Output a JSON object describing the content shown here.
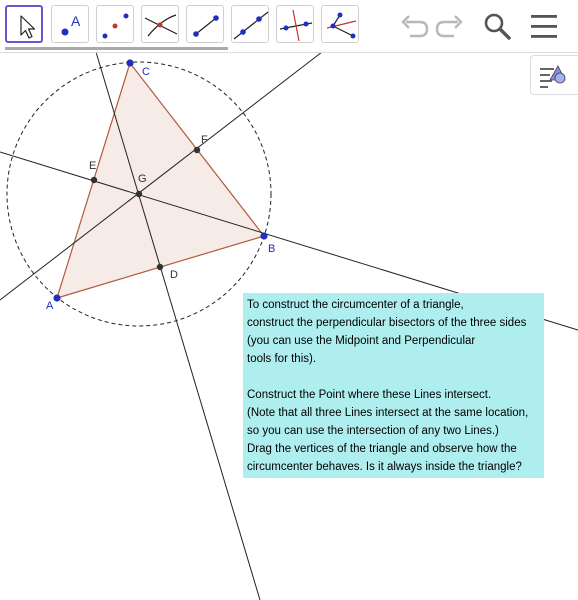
{
  "toolbar": {
    "tools": [
      {
        "name": "Move",
        "icon": "move-arrow-icon",
        "active": true
      },
      {
        "name": "Point",
        "icon": "point-icon"
      },
      {
        "name": "Midpoint or Center",
        "icon": "midpoint-icon"
      },
      {
        "name": "Intersect",
        "icon": "intersect-icon"
      },
      {
        "name": "Segment",
        "icon": "segment-icon"
      },
      {
        "name": "Line",
        "icon": "line-icon"
      },
      {
        "name": "Perpendicular Bisector",
        "icon": "perpendicular-bisector-icon"
      },
      {
        "name": "Angle Bisector",
        "icon": "angle-bisector-icon"
      }
    ],
    "right_icons": [
      "undo-icon",
      "redo-icon",
      "search-icon",
      "menu-icon"
    ]
  },
  "algebra_toggle": {
    "icon": "algebra-view-toggle-icon"
  },
  "point_labels": {
    "A": "A",
    "B": "B",
    "C": "C",
    "D": "D",
    "E": "E",
    "F": "F",
    "G": "G"
  },
  "colors": {
    "point_blue": "#1f2fbf",
    "triangle_fill": "#f4e4df",
    "triangle_edge": "#b15a3c",
    "info_bg": "#aeeeee",
    "tool_active_border": "#6557d2"
  },
  "info_text": {
    "line1": "To construct the circumcenter of a triangle,",
    "line2": "construct the perpendicular bisectors of the three sides",
    "line3": "(you can use the Midpoint and Perpendicular",
    "line4": "tools for this).",
    "line5": "Construct the Point where these Lines intersect.",
    "line6": "(Note that all three Lines intersect at the same location,",
    "line7": "so you can use the intersection of any two Lines.)",
    "line8": "Drag the vertices of the triangle and observe how the",
    "line9": "circumcenter behaves. Is it always inside the triangle?"
  }
}
